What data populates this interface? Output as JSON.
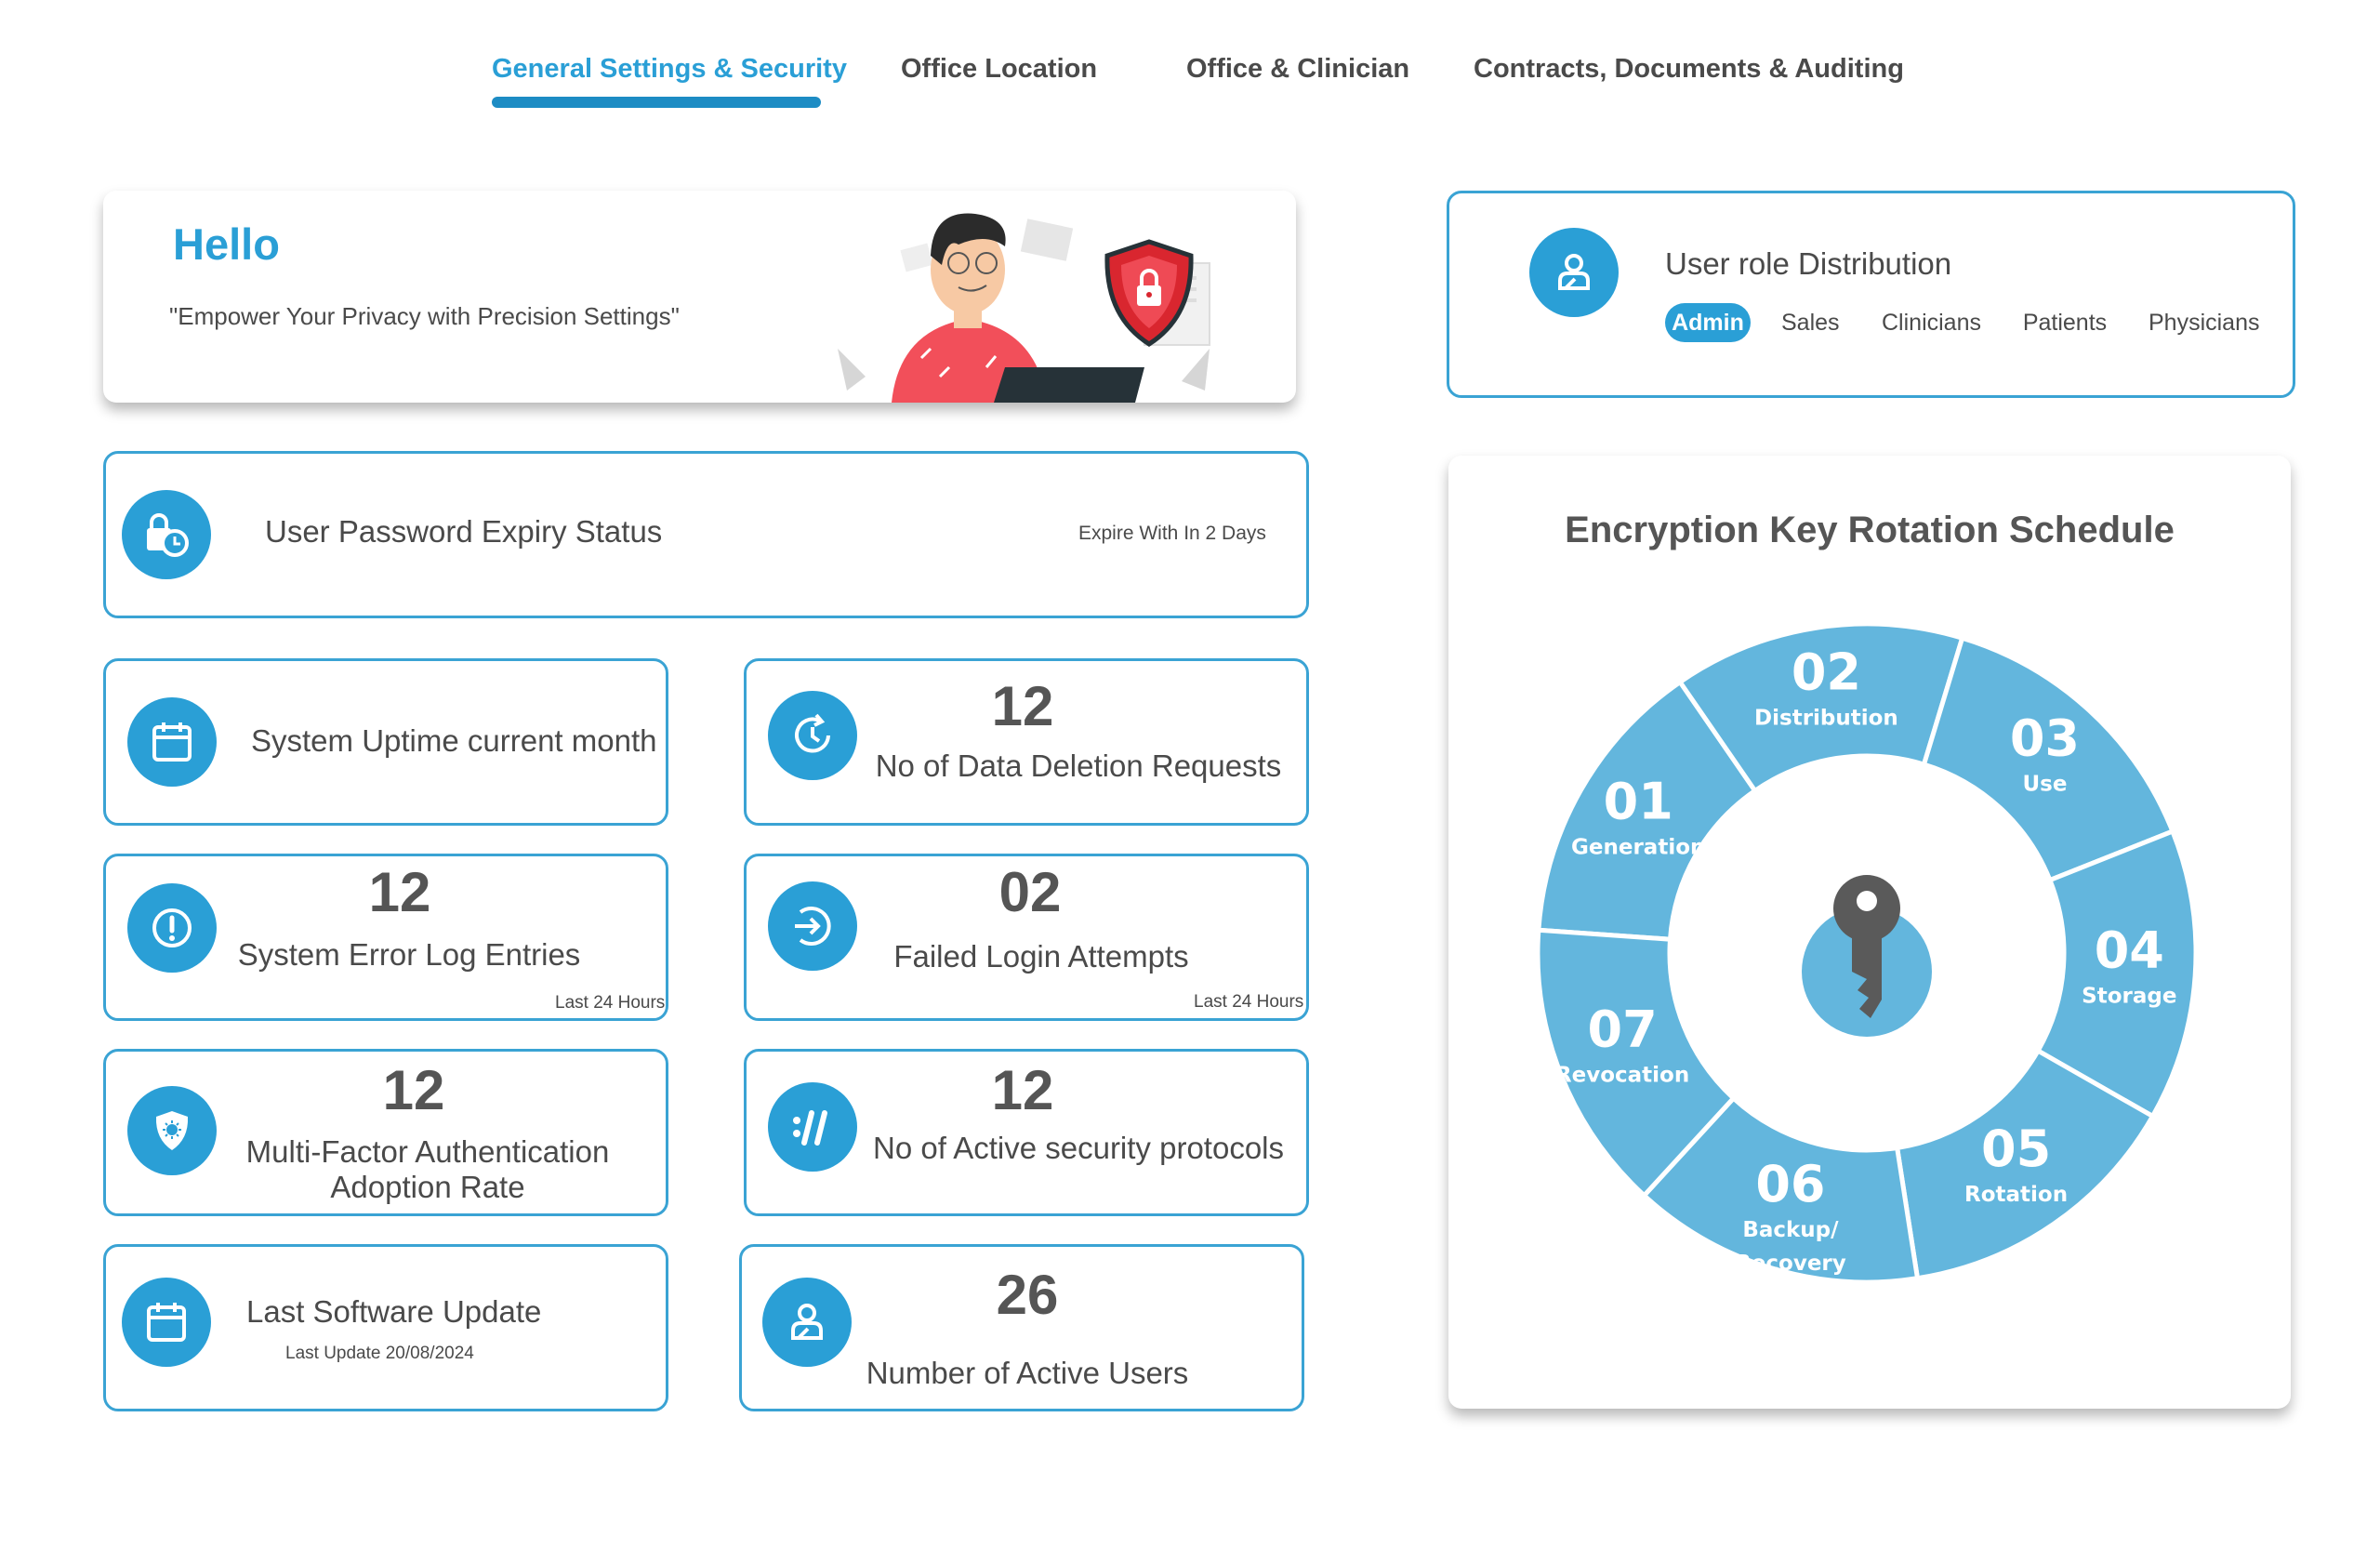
{
  "tabs": [
    {
      "label": "General Settings & Security",
      "active": true
    },
    {
      "label": "Office Location",
      "active": false
    },
    {
      "label": "Office & Clinician",
      "active": false
    },
    {
      "label": "Contracts, Documents & Auditing",
      "active": false
    }
  ],
  "hello": {
    "title": "Hello",
    "subtitle": "\"Empower Your Privacy with Precision Settings\""
  },
  "roles": {
    "title": "User role Distribution",
    "items": [
      "Admin",
      "Sales",
      "Clinicians",
      "Patients",
      "Physicians"
    ],
    "selected": "Admin"
  },
  "password": {
    "title": "User Password Expiry Status",
    "note": "Expire With In 2 Days"
  },
  "stats": {
    "uptime": {
      "label": "System Uptime current month"
    },
    "deletion": {
      "value": "12",
      "label": "No of Data Deletion Requests"
    },
    "errors": {
      "value": "12",
      "label": "System Error Log Entries",
      "note": "Last 24 Hours"
    },
    "failed_login": {
      "value": "02",
      "label": "Failed Login Attempts",
      "note": "Last 24 Hours"
    },
    "mfa": {
      "value": "12",
      "label_line1": "Multi-Factor Authentication",
      "label_line2": "Adoption Rate"
    },
    "protocols": {
      "value": "12",
      "label": "No of Active security protocols"
    },
    "software": {
      "label": "Last Software Update",
      "note": "Last Update 20/08/2024"
    },
    "active_users": {
      "value": "26",
      "label": "Number of Active Users"
    }
  },
  "encryption": {
    "title": "Encryption Key Rotation Schedule",
    "segments": [
      {
        "num": "01",
        "label": "Generation"
      },
      {
        "num": "02",
        "label": "Distribution"
      },
      {
        "num": "03",
        "label": "Use"
      },
      {
        "num": "04",
        "label": "Storage"
      },
      {
        "num": "05",
        "label": "Rotation"
      },
      {
        "num": "06",
        "label": "Backup/ Recovery"
      },
      {
        "num": "07",
        "label": "Revocation"
      }
    ]
  },
  "colors": {
    "accent": "#2a9fd6",
    "border": "#3aa3d4",
    "wheel": "#63b6dd",
    "underline": "#1d8cc4",
    "text": "#4a4a4a"
  },
  "icons": {
    "password": "lock-clock-icon",
    "uptime": "calendar-icon",
    "deletion": "clock-refresh-icon",
    "errors": "alert-icon",
    "failed_login": "login-arrow-icon",
    "mfa": "shield-icon",
    "protocols": "protocol-slash-icon",
    "software": "calendar-icon",
    "active_users": "user-icon",
    "roles": "user-icon",
    "key": "key-icon"
  }
}
